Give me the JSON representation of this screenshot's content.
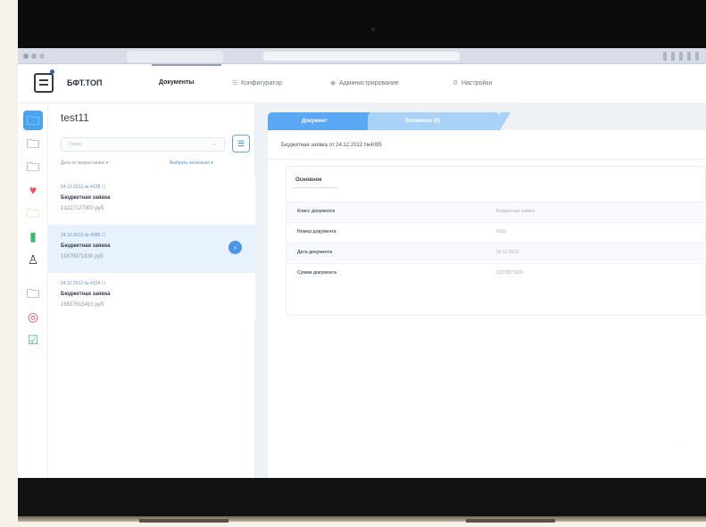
{
  "app": {
    "brand": "БФТ.ТОП"
  },
  "nav": {
    "items": [
      {
        "label": "Документы"
      },
      {
        "label": "Конфигуратор"
      },
      {
        "label": "Администрирование"
      },
      {
        "label": "Настройки"
      }
    ]
  },
  "list": {
    "title": "test11",
    "search_placeholder": "Поиск",
    "sort_by": "Дата по возрастанию ▾",
    "select_fields": "Выбрать несколько ▾",
    "items": [
      {
        "meta": "24.12.2012 № 4128 ☐",
        "name": "Бюджетная заявка",
        "amount": "13227127000 руб"
      },
      {
        "meta": "24.12.2013 № 4095 ☐",
        "name": "Бюджетная заявка",
        "amount": "11879971830 руб"
      },
      {
        "meta": "24.12.2012 № 4124 ☐",
        "name": "Бюджетная заявка",
        "amount": "16597615410 руб"
      }
    ]
  },
  "detail": {
    "tabs": [
      {
        "label": "Документ"
      },
      {
        "label": "Вложения (0)"
      }
    ],
    "heading": "Бюджетная заявка от 24.12.2012 №4095",
    "section_title": "Основное",
    "properties": [
      {
        "label": "Класс документа",
        "value": "Бюджетная заявка"
      },
      {
        "label": "Номер документа",
        "value": "4095"
      },
      {
        "label": "Дата документа",
        "value": "24.12.2013"
      },
      {
        "label": "Сумма документа",
        "value": "11879971830"
      }
    ]
  },
  "colors": {
    "accent": "#4AA3F2",
    "selected_row": "#E8F2FE",
    "detail_background": "#EEF2F7"
  },
  "icons": {
    "sidebar": [
      "folder-icon",
      "folder-outline-icon",
      "folder-outline-icon",
      "tag-icon",
      "folder-yellow-icon",
      "battery-icon",
      "users-icon",
      "folder-outline-icon",
      "target-icon",
      "check-square-icon"
    ]
  }
}
